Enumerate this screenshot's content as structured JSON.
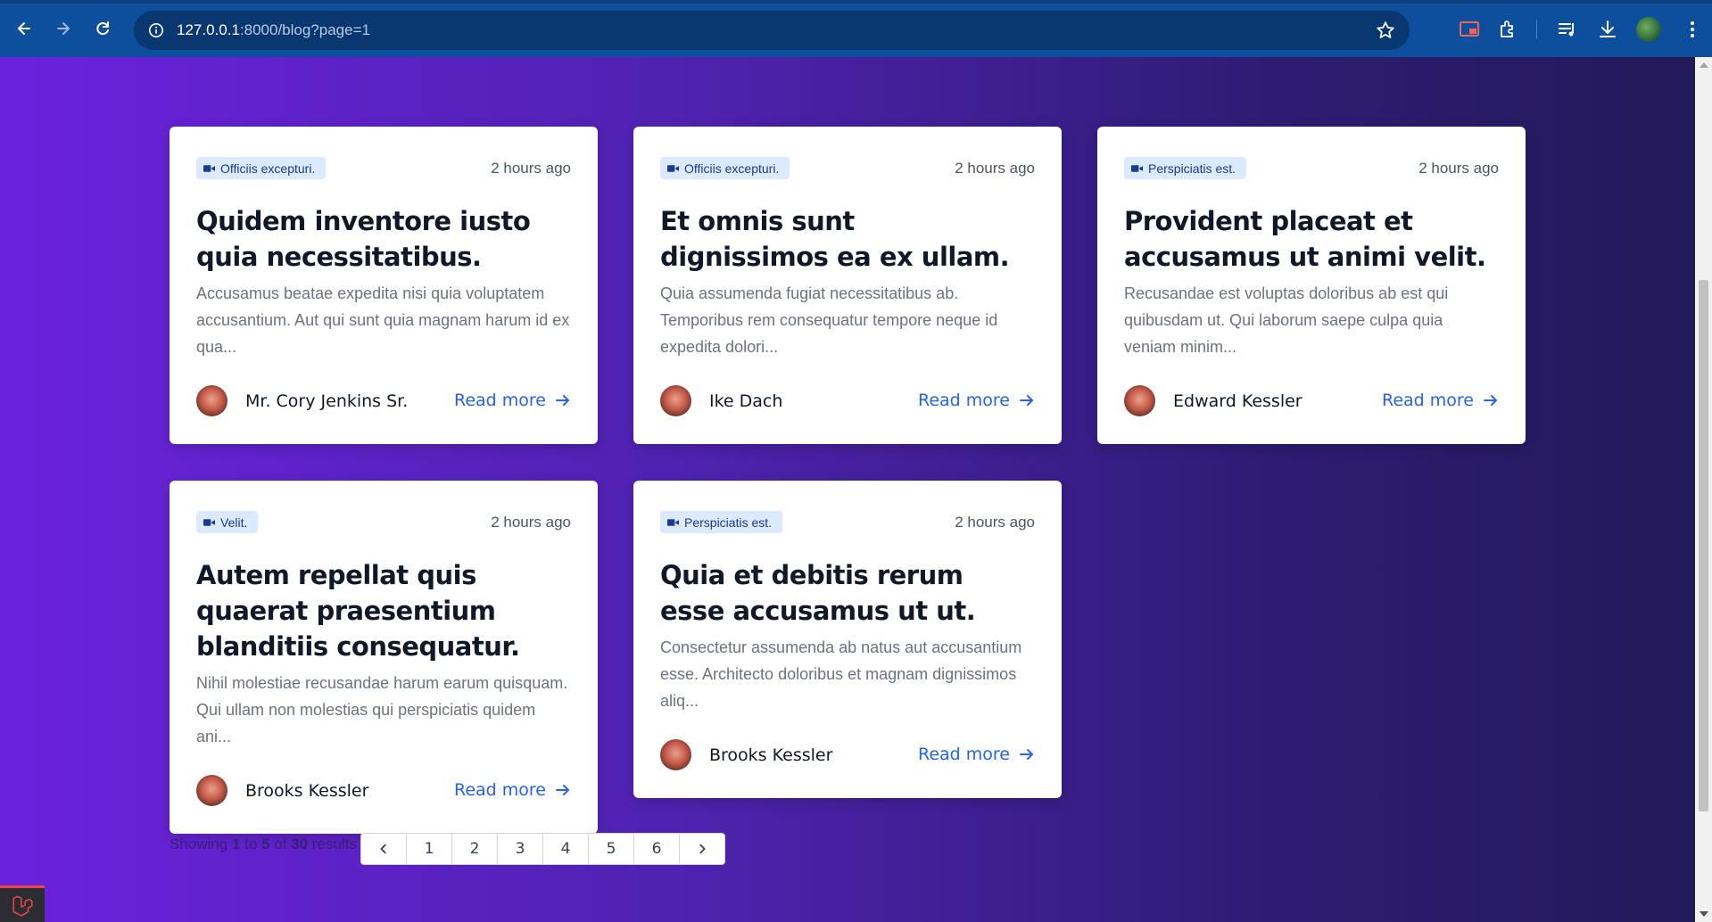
{
  "browser": {
    "url_host": "127.0.0.1",
    "url_rest": ":8000/blog?page=1"
  },
  "posts": [
    {
      "tag": "Officiis excepturi.",
      "time": "2 hours ago",
      "title": "Quidem inventore iusto quia necessitatibus.",
      "excerpt": "Accusamus beatae expedita nisi quia voluptatem accusantium. Aut qui sunt quia magnam harum id ex qua...",
      "author": "Mr. Cory Jenkins Sr.",
      "read_more": "Read more"
    },
    {
      "tag": "Officiis excepturi.",
      "time": "2 hours ago",
      "title": "Et omnis sunt dignissimos ea ex ullam.",
      "excerpt": "Quia assumenda fugiat necessitatibus ab. Temporibus rem consequatur tempore neque id expedita dolori...",
      "author": "Ike Dach",
      "read_more": "Read more"
    },
    {
      "tag": "Perspiciatis est.",
      "time": "2 hours ago",
      "title": "Provident placeat et accusamus ut animi velit.",
      "excerpt": "Recusandae est voluptas doloribus ab est qui quibusdam ut. Qui laborum saepe culpa quia veniam minim...",
      "author": "Edward Kessler",
      "read_more": "Read more"
    },
    {
      "tag": "Velit.",
      "time": "2 hours ago",
      "title": "Autem repellat quis quaerat praesentium blanditiis consequatur.",
      "excerpt": "Nihil molestiae recusandae harum earum quisquam. Qui ullam non molestias qui perspiciatis quidem ani...",
      "author": "Brooks Kessler",
      "read_more": "Read more"
    },
    {
      "tag": "Perspiciatis est.",
      "time": "2 hours ago",
      "title": "Quia et debitis rerum esse accusamus ut ut.",
      "excerpt": "Consectetur assumenda ab natus aut accusantium esse. Architecto doloribus et magnam dignissimos aliq...",
      "author": "Brooks Kessler",
      "read_more": "Read more"
    }
  ],
  "pagination": {
    "showing": "Showing",
    "from": "1",
    "to_word": "to",
    "to": "5",
    "of_word": "of",
    "total": "30",
    "results_word": "results",
    "pages": [
      "1",
      "2",
      "3",
      "4",
      "5",
      "6"
    ]
  },
  "colors": {
    "accent": "#2563eb",
    "tag_bg": "#dbeafe",
    "tag_text": "#1e3a8a",
    "browser_bar": "#0d4f9c"
  }
}
